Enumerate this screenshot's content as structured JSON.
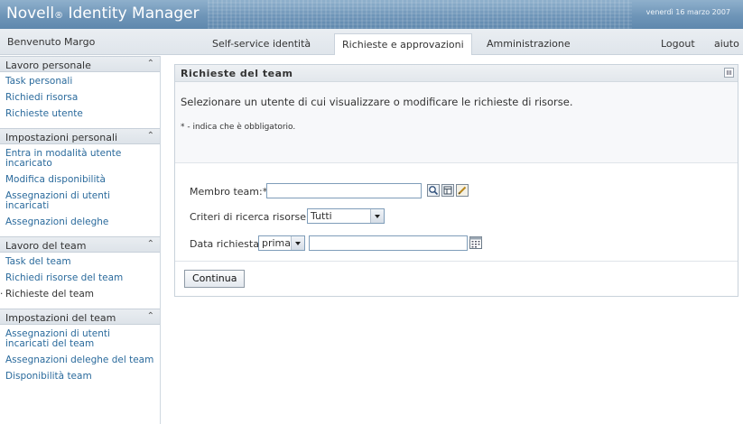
{
  "header": {
    "brand_name": "Novell",
    "brand_reg": "®",
    "brand_product": " Identity Manager",
    "date": "venerdì 16 marzo 2007"
  },
  "tabbar": {
    "welcome": "Benvenuto Margo",
    "tabs": [
      {
        "label": "Self-service identità",
        "active": false
      },
      {
        "label": "Richieste e approvazioni",
        "active": true
      },
      {
        "label": "Amministrazione",
        "active": false
      }
    ],
    "logout": "Logout",
    "help": "aiuto"
  },
  "sidebar": {
    "groups": [
      {
        "title": "Lavoro personale",
        "items": [
          "Task personali",
          "Richiedi risorsa",
          "Richieste utente"
        ]
      },
      {
        "title": "Impostazioni personali",
        "items": [
          "Entra in modalità utente incaricato",
          "Modifica disponibilità",
          "Assegnazioni di utenti incaricati",
          "Assegnazioni deleghe"
        ]
      },
      {
        "title": "Lavoro del team",
        "items": [
          "Task del team",
          "Richiedi risorse del team",
          "Richieste del team"
        ],
        "current": 2
      },
      {
        "title": "Impostazioni del team",
        "items": [
          "Assegnazioni di utenti incaricati del team",
          "Assegnazioni deleghe del team",
          "Disponibilità team"
        ]
      }
    ]
  },
  "panel": {
    "title": "Richieste del team",
    "description": "Selezionare un utente di cui visualizzare o modificare le richieste di risorse.",
    "required_note": "* - indica che è obbligatorio.",
    "team_member_label": "Membro team:*",
    "team_member_value": "",
    "criteria_label": "Criteri di ricerca risorse:",
    "criteria_value": "Tutti",
    "date_label": "Data richiesta:",
    "date_op_value": "prima",
    "date_value": "",
    "continue_label": "Continua"
  },
  "colors": {
    "banner": "#6e95b8",
    "link": "#2a6a9c"
  }
}
